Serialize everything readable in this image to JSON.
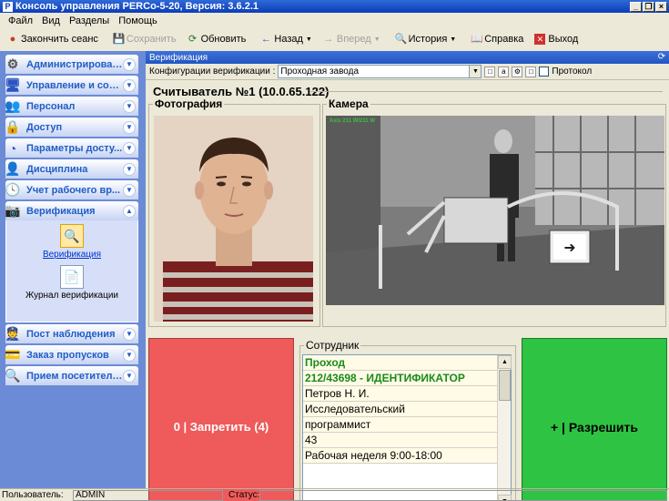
{
  "window": {
    "title": "Консоль управления PERCo-5-20, Версия: 3.6.2.1"
  },
  "menu": [
    "Файл",
    "Вид",
    "Разделы",
    "Помощь"
  ],
  "toolbar": {
    "end_session": "Закончить сеанс",
    "save": "Сохранить",
    "refresh": "Обновить",
    "back": "Назад",
    "forward": "Вперед",
    "history": "История",
    "help": "Справка",
    "exit": "Выход"
  },
  "nav": {
    "items": [
      {
        "label": "Администрирование"
      },
      {
        "label": "Управление и соб..."
      },
      {
        "label": "Персонал"
      },
      {
        "label": "Доступ"
      },
      {
        "label": "Параметры досту..."
      },
      {
        "label": "Дисциплина"
      },
      {
        "label": "Учет рабочего вр..."
      },
      {
        "label": "Верификация"
      },
      {
        "label": "Пост наблюдения"
      },
      {
        "label": "Заказ пропусков"
      },
      {
        "label": "Прием посетителей"
      }
    ],
    "sub": [
      {
        "label": "Верификация"
      },
      {
        "label": "Журнал верификации"
      }
    ]
  },
  "main": {
    "header": "Верификация",
    "cfg_label": "Конфигурации верификации :",
    "cfg_value": "Проходная завода",
    "protocol_label": "Протокол",
    "reader_title": "Считыватель №1 (10.0.65.122)",
    "photo_label": "Фотография",
    "camera_label": "Камера",
    "camera_overlay": "Axis 211 W/211 W",
    "deny_label": "0 | Запретить (4)",
    "allow_label": "+ | Разрешить",
    "employee_label": "Сотрудник",
    "employee_rows": [
      "Проход",
      "212/43698 - ИДЕНТИФИКАТОР",
      "Петров Н. И.",
      "Исследовательский",
      "программист",
      "43",
      "Рабочая неделя 9:00-18:00"
    ]
  },
  "status": {
    "user_label": "Пользователь:",
    "user_value": "ADMIN",
    "status_label": "Статус:"
  }
}
